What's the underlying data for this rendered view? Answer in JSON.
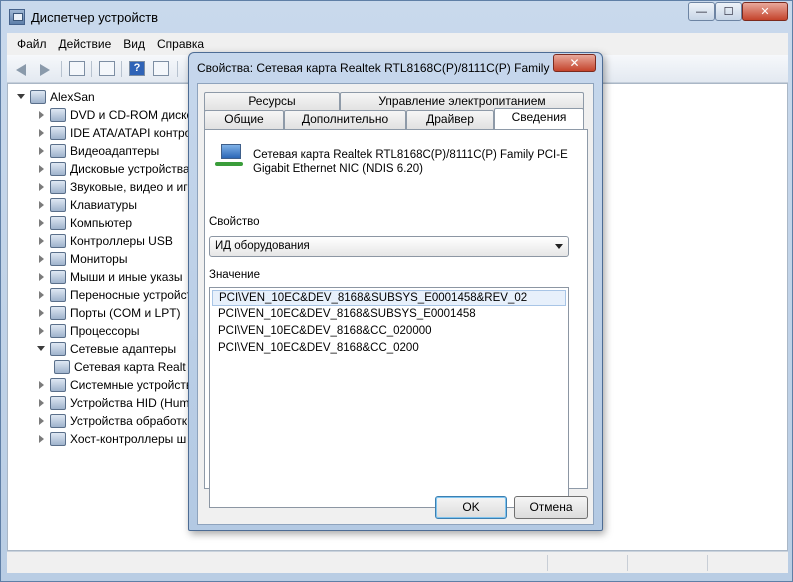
{
  "main_window": {
    "title": "Диспетчер устройств",
    "buttons": {
      "minimize": "—",
      "maximize": "☐",
      "close": "✕"
    }
  },
  "menu": [
    "Файл",
    "Действие",
    "Вид",
    "Справка"
  ],
  "tree": {
    "root": "AlexSan",
    "items": [
      {
        "label": "DVD и CD-ROM дисково",
        "expanded": false
      },
      {
        "label": "IDE ATA/ATAPI контро",
        "expanded": false
      },
      {
        "label": "Видеоадаптеры",
        "expanded": false
      },
      {
        "label": "Дисковые устройства",
        "expanded": false
      },
      {
        "label": "Звуковые, видео и игр",
        "expanded": false
      },
      {
        "label": "Клавиатуры",
        "expanded": false
      },
      {
        "label": "Компьютер",
        "expanded": false
      },
      {
        "label": "Контроллеры USB",
        "expanded": false
      },
      {
        "label": "Мониторы",
        "expanded": false
      },
      {
        "label": "Мыши и иные указы",
        "expanded": false
      },
      {
        "label": "Переносные устройст",
        "expanded": false
      },
      {
        "label": "Порты (COM и LPT)",
        "expanded": false
      },
      {
        "label": "Процессоры",
        "expanded": false
      },
      {
        "label": "Сетевые адаптеры",
        "expanded": true
      },
      {
        "label": "Сетевая карта Realt",
        "child": true
      },
      {
        "label": "Системные устройств",
        "expanded": false
      },
      {
        "label": "Устройства HID (Hum",
        "expanded": false
      },
      {
        "label": "Устройства обработк",
        "expanded": false
      },
      {
        "label": "Хост-контроллеры ш",
        "expanded": false
      }
    ]
  },
  "dialog": {
    "title": "Свойства: Сетевая карта Realtek RTL8168C(P)/8111C(P) Family ...",
    "close": "✕",
    "tabs_back": [
      "Ресурсы",
      "Управление электропитанием"
    ],
    "tabs_front": [
      "Общие",
      "Дополнительно",
      "Драйвер",
      "Сведения"
    ],
    "active_tab": "Сведения",
    "device_name": "Сетевая карта Realtek RTL8168C(P)/8111C(P) Family PCI-E Gigabit Ethernet NIC (NDIS 6.20)",
    "property_label": "Свойство",
    "property_value": "ИД оборудования",
    "value_label": "Значение",
    "values": [
      "PCI\\VEN_10EC&DEV_8168&SUBSYS_E0001458&REV_02",
      "PCI\\VEN_10EC&DEV_8168&SUBSYS_E0001458",
      "PCI\\VEN_10EC&DEV_8168&CC_020000",
      "PCI\\VEN_10EC&DEV_8168&CC_0200"
    ],
    "ok_button": "OK",
    "cancel_button": "Отмена"
  }
}
